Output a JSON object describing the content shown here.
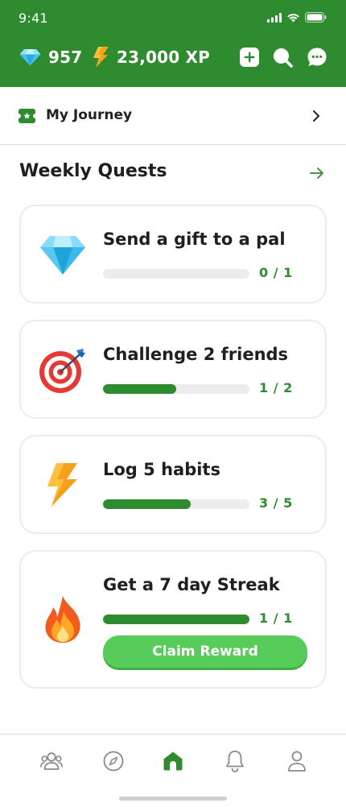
{
  "status_bar": {
    "time": "9:41",
    "icons": [
      "signal-icon",
      "wifi-icon",
      "battery-icon"
    ]
  },
  "header": {
    "gems": {
      "icon": "diamond-icon",
      "value": "957"
    },
    "xp": {
      "icon": "lightning-icon",
      "value": "23,000 XP"
    },
    "actions": [
      "add-icon",
      "search-icon",
      "chat-icon"
    ]
  },
  "journey": {
    "icon": "ticket-icon",
    "label": "My Journey",
    "chevron": "chevron-right-icon"
  },
  "weekly_quests": {
    "title": "Weekly Quests",
    "arrow": "arrow-right-icon",
    "quests": [
      {
        "icon": "diamond-icon",
        "title": "Send a gift to a pal",
        "progress_text": "0 / 1",
        "current": 0,
        "total": 1
      },
      {
        "icon": "target-icon",
        "title": "Challenge 2 friends",
        "progress_text": "1 / 2",
        "current": 1,
        "total": 2
      },
      {
        "icon": "lightning-icon",
        "title": "Log 5 habits",
        "progress_text": "3 / 5",
        "current": 3,
        "total": 5
      },
      {
        "icon": "fire-icon",
        "title": "Get a 7 day Streak",
        "progress_text": "1 / 1",
        "current": 1,
        "total": 1,
        "button_label": "Claim Reward"
      }
    ]
  },
  "bottom_nav": {
    "items": [
      {
        "name": "friends",
        "icon": "people-icon",
        "active": false
      },
      {
        "name": "explore",
        "icon": "compass-icon",
        "active": false
      },
      {
        "name": "home",
        "icon": "home-icon",
        "active": true
      },
      {
        "name": "notifications",
        "icon": "bell-icon",
        "active": false
      },
      {
        "name": "profile",
        "icon": "person-icon",
        "active": false
      }
    ]
  },
  "colors": {
    "brand_green": "#2e8b2f",
    "button_green": "#58cc5a",
    "track_grey": "#ececec",
    "nav_inactive": "#8a8a8a"
  }
}
